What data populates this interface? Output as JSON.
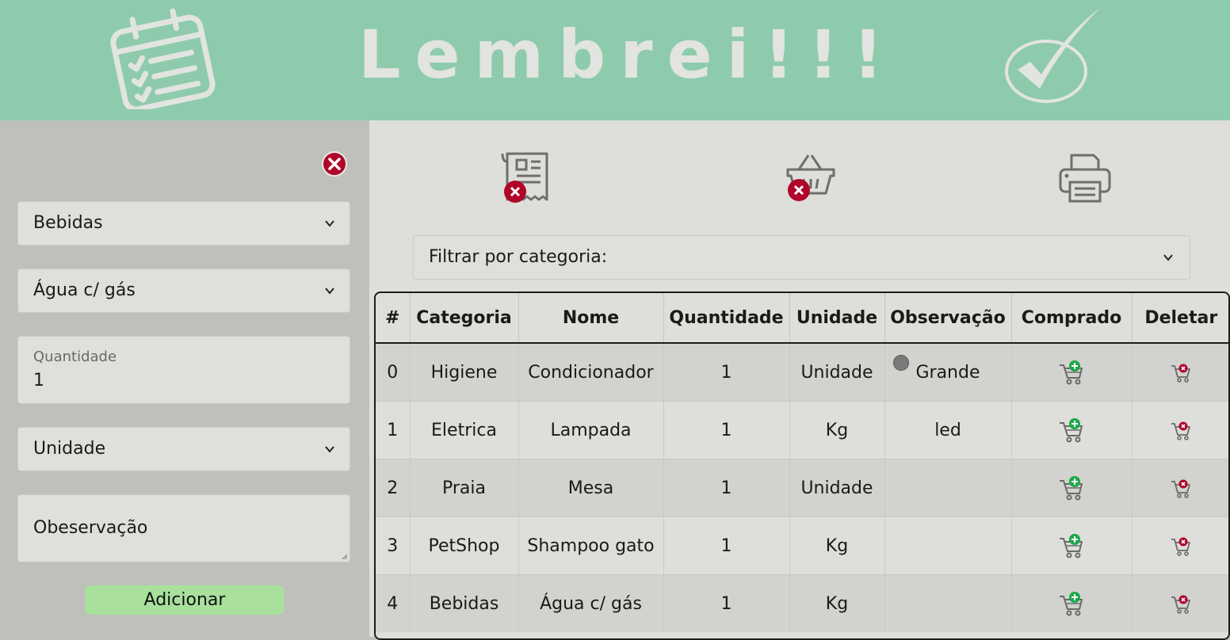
{
  "header": {
    "title": "Lembrei!!!",
    "left_icon": "calendar-checklist-icon",
    "right_icon": "checkmark-icon",
    "color": "#8ecbad"
  },
  "sidebar": {
    "category_select": "Bebidas",
    "product_select": "Água c/ gás",
    "quantity_label": "Quantidade",
    "quantity_value": "1",
    "unit_select": "Unidade",
    "observation_placeholder": "Obeservação",
    "add_button": "Adicionar",
    "close_icon": "close-circle-icon"
  },
  "toolbar": {
    "icons": [
      "clear-list-icon",
      "clear-basket-icon",
      "printer-icon"
    ]
  },
  "filter": {
    "label": "Filtrar por categoria:"
  },
  "table": {
    "headers": [
      "#",
      "Categoria",
      "Nome",
      "Quantidade",
      "Unidade",
      "Observação",
      "Comprado",
      "Deletar"
    ],
    "rows": [
      {
        "id": "0",
        "categoria": "Higiene",
        "nome": "Condicionador",
        "quantidade": "1",
        "unidade": "Unidade",
        "observacao": "Grande"
      },
      {
        "id": "1",
        "categoria": "Eletrica",
        "nome": "Lampada",
        "quantidade": "1",
        "unidade": "Kg",
        "observacao": "led"
      },
      {
        "id": "2",
        "categoria": "Praia",
        "nome": "Mesa",
        "quantidade": "1",
        "unidade": "Unidade",
        "observacao": ""
      },
      {
        "id": "3",
        "categoria": "PetShop",
        "nome": "Shampoo gato",
        "quantidade": "1",
        "unidade": "Kg",
        "observacao": ""
      },
      {
        "id": "4",
        "categoria": "Bebidas",
        "nome": "Água c/ gás",
        "quantidade": "1",
        "unidade": "Kg",
        "observacao": ""
      }
    ]
  },
  "colors": {
    "accent_green": "#8ecbad",
    "button_green": "#a8e09c",
    "danger_red": "#b0062a",
    "cart_green": "#1fa84a"
  }
}
